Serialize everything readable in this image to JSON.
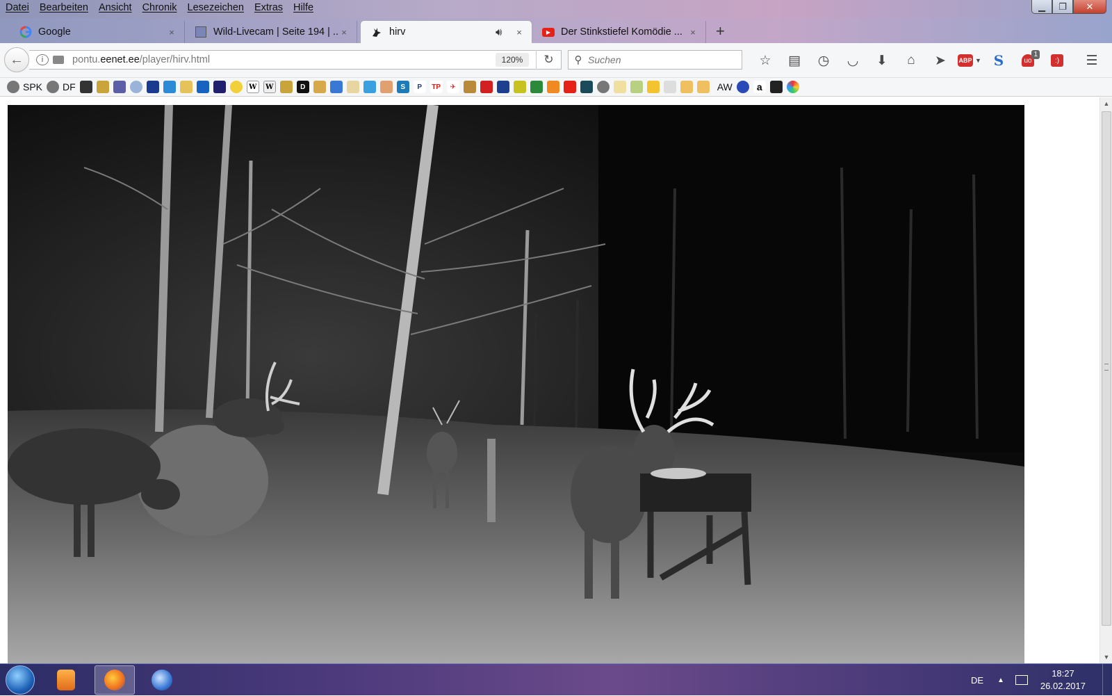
{
  "menu": [
    "Datei",
    "Bearbeiten",
    "Ansicht",
    "Chronik",
    "Lesezeichen",
    "Extras",
    "Hilfe"
  ],
  "tabs": [
    {
      "label": "Google",
      "close": "×"
    },
    {
      "label": "Wild-Livecam | Seite 194 | ...",
      "close": "×"
    },
    {
      "label": "hirv",
      "close": "×"
    },
    {
      "label": "Der Stinkstiefel Komödie ...",
      "close": "×"
    }
  ],
  "new_tab": "+",
  "address": {
    "prefix": "pontu.",
    "domain": "eenet.ee",
    "path": "/player/hirv.html",
    "zoom": "120%"
  },
  "search": {
    "placeholder": "Suchen"
  },
  "toolbar": {
    "abp_label": "ABP",
    "ublock_badge": "1"
  },
  "bookmarks": [
    "SPK",
    "DF",
    "AW"
  ],
  "taskbar": {
    "language": "DE",
    "time": "18:27",
    "date": "26.02.2017"
  }
}
